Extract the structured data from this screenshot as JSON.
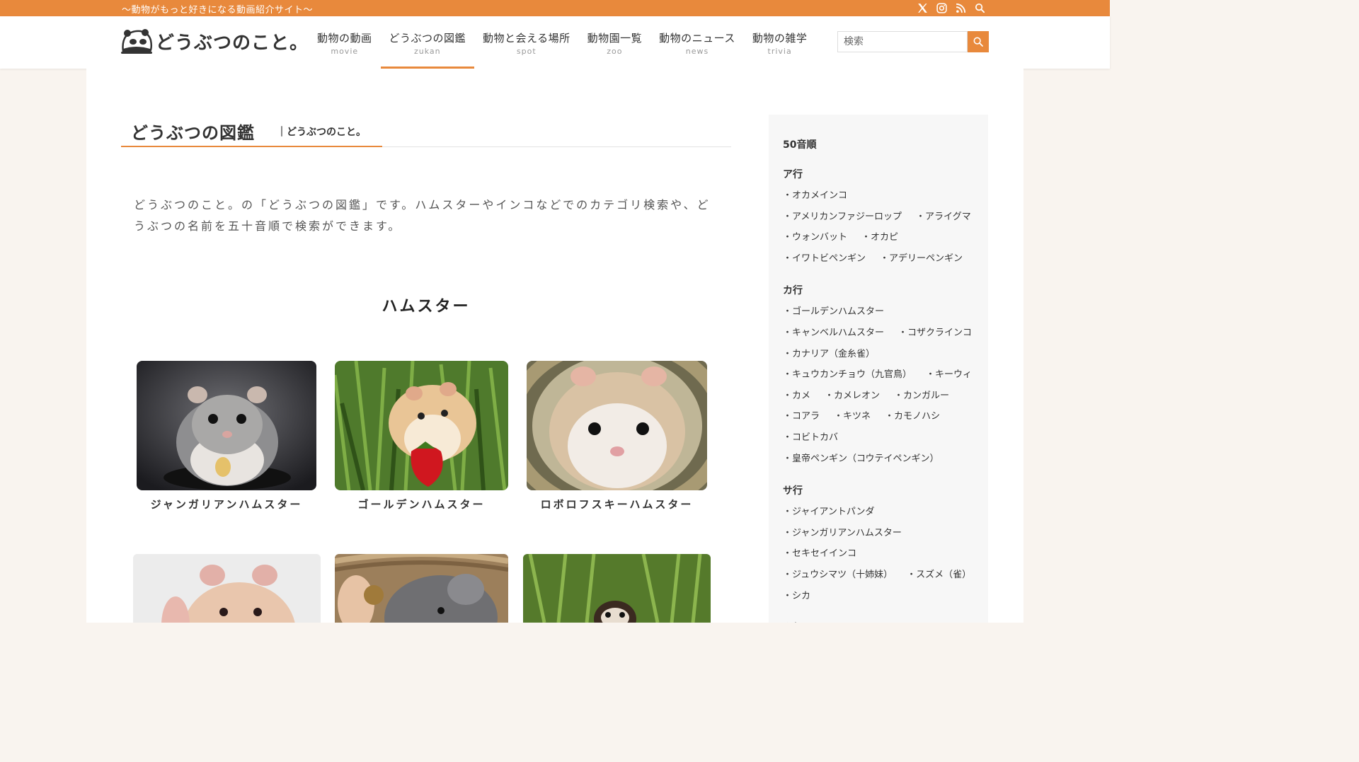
{
  "topbar": {
    "tagline": "〜動物がもっと好きになる動画紹介サイト〜",
    "icons": [
      "x-icon",
      "instagram-icon",
      "rss-icon",
      "search-icon"
    ]
  },
  "header": {
    "logo_text": "どうぶつのこと。",
    "nav": [
      {
        "jp": "動物の動画",
        "en": "movie"
      },
      {
        "jp": "どうぶつの図鑑",
        "en": "zukan"
      },
      {
        "jp": "動物と会える場所",
        "en": "spot"
      },
      {
        "jp": "動物園一覧",
        "en": "zoo"
      },
      {
        "jp": "動物のニュース",
        "en": "news"
      },
      {
        "jp": "動物の雑学",
        "en": "trivia"
      }
    ],
    "active_nav": 1,
    "search_placeholder": "検索"
  },
  "main": {
    "page_title": "どうぶつの図鑑",
    "site_sub": "｜どうぶつのこと。",
    "intro": "どうぶつのこと。の「どうぶつの図鑑」です。ハムスターやインコなどでのカテゴリ検索や、どうぶつの名前を五十音順で検索ができます。",
    "section_title": "ハムスター",
    "cards": [
      {
        "caption": "ジャンガリアンハムスター"
      },
      {
        "caption": "ゴールデンハムスター"
      },
      {
        "caption": "ロボロフスキーハムスター"
      }
    ]
  },
  "sidebar": {
    "heading": "50音順",
    "groups": [
      {
        "title": "ア行",
        "items": [
          "・オカメインコ",
          "・アメリカンファジーロップ",
          "・アライグマ",
          "・ウォンバット",
          "・オカピ",
          "・イワトビペンギン",
          "・アデリーペンギン"
        ]
      },
      {
        "title": "カ行",
        "items": [
          "・ゴールデンハムスター",
          "・キャンベルハムスター",
          "・コザクラインコ",
          "・カナリア（金糸雀）",
          "・キュウカンチョウ（九官鳥）",
          "・キーウィ",
          "・カメ",
          "・カメレオン",
          "・カンガルー",
          "・コアラ",
          "・キツネ",
          "・カモノハシ",
          "・コビトカバ",
          "・皇帝ペンギン（コウテイペンギン）"
        ]
      },
      {
        "title": "サ行",
        "items": [
          "・ジャイアントパンダ",
          "・ジャンガリアンハムスター",
          "・セキセイインコ",
          "・ジュウシマツ（十姉妹）",
          "・スズメ（雀）",
          "・シカ"
        ]
      },
      {
        "title": "タ行",
        "items": []
      }
    ]
  },
  "colors": {
    "accent": "#e8893c",
    "bg": "#f9f4ef",
    "sidebar_bg": "#f7f7f7"
  }
}
